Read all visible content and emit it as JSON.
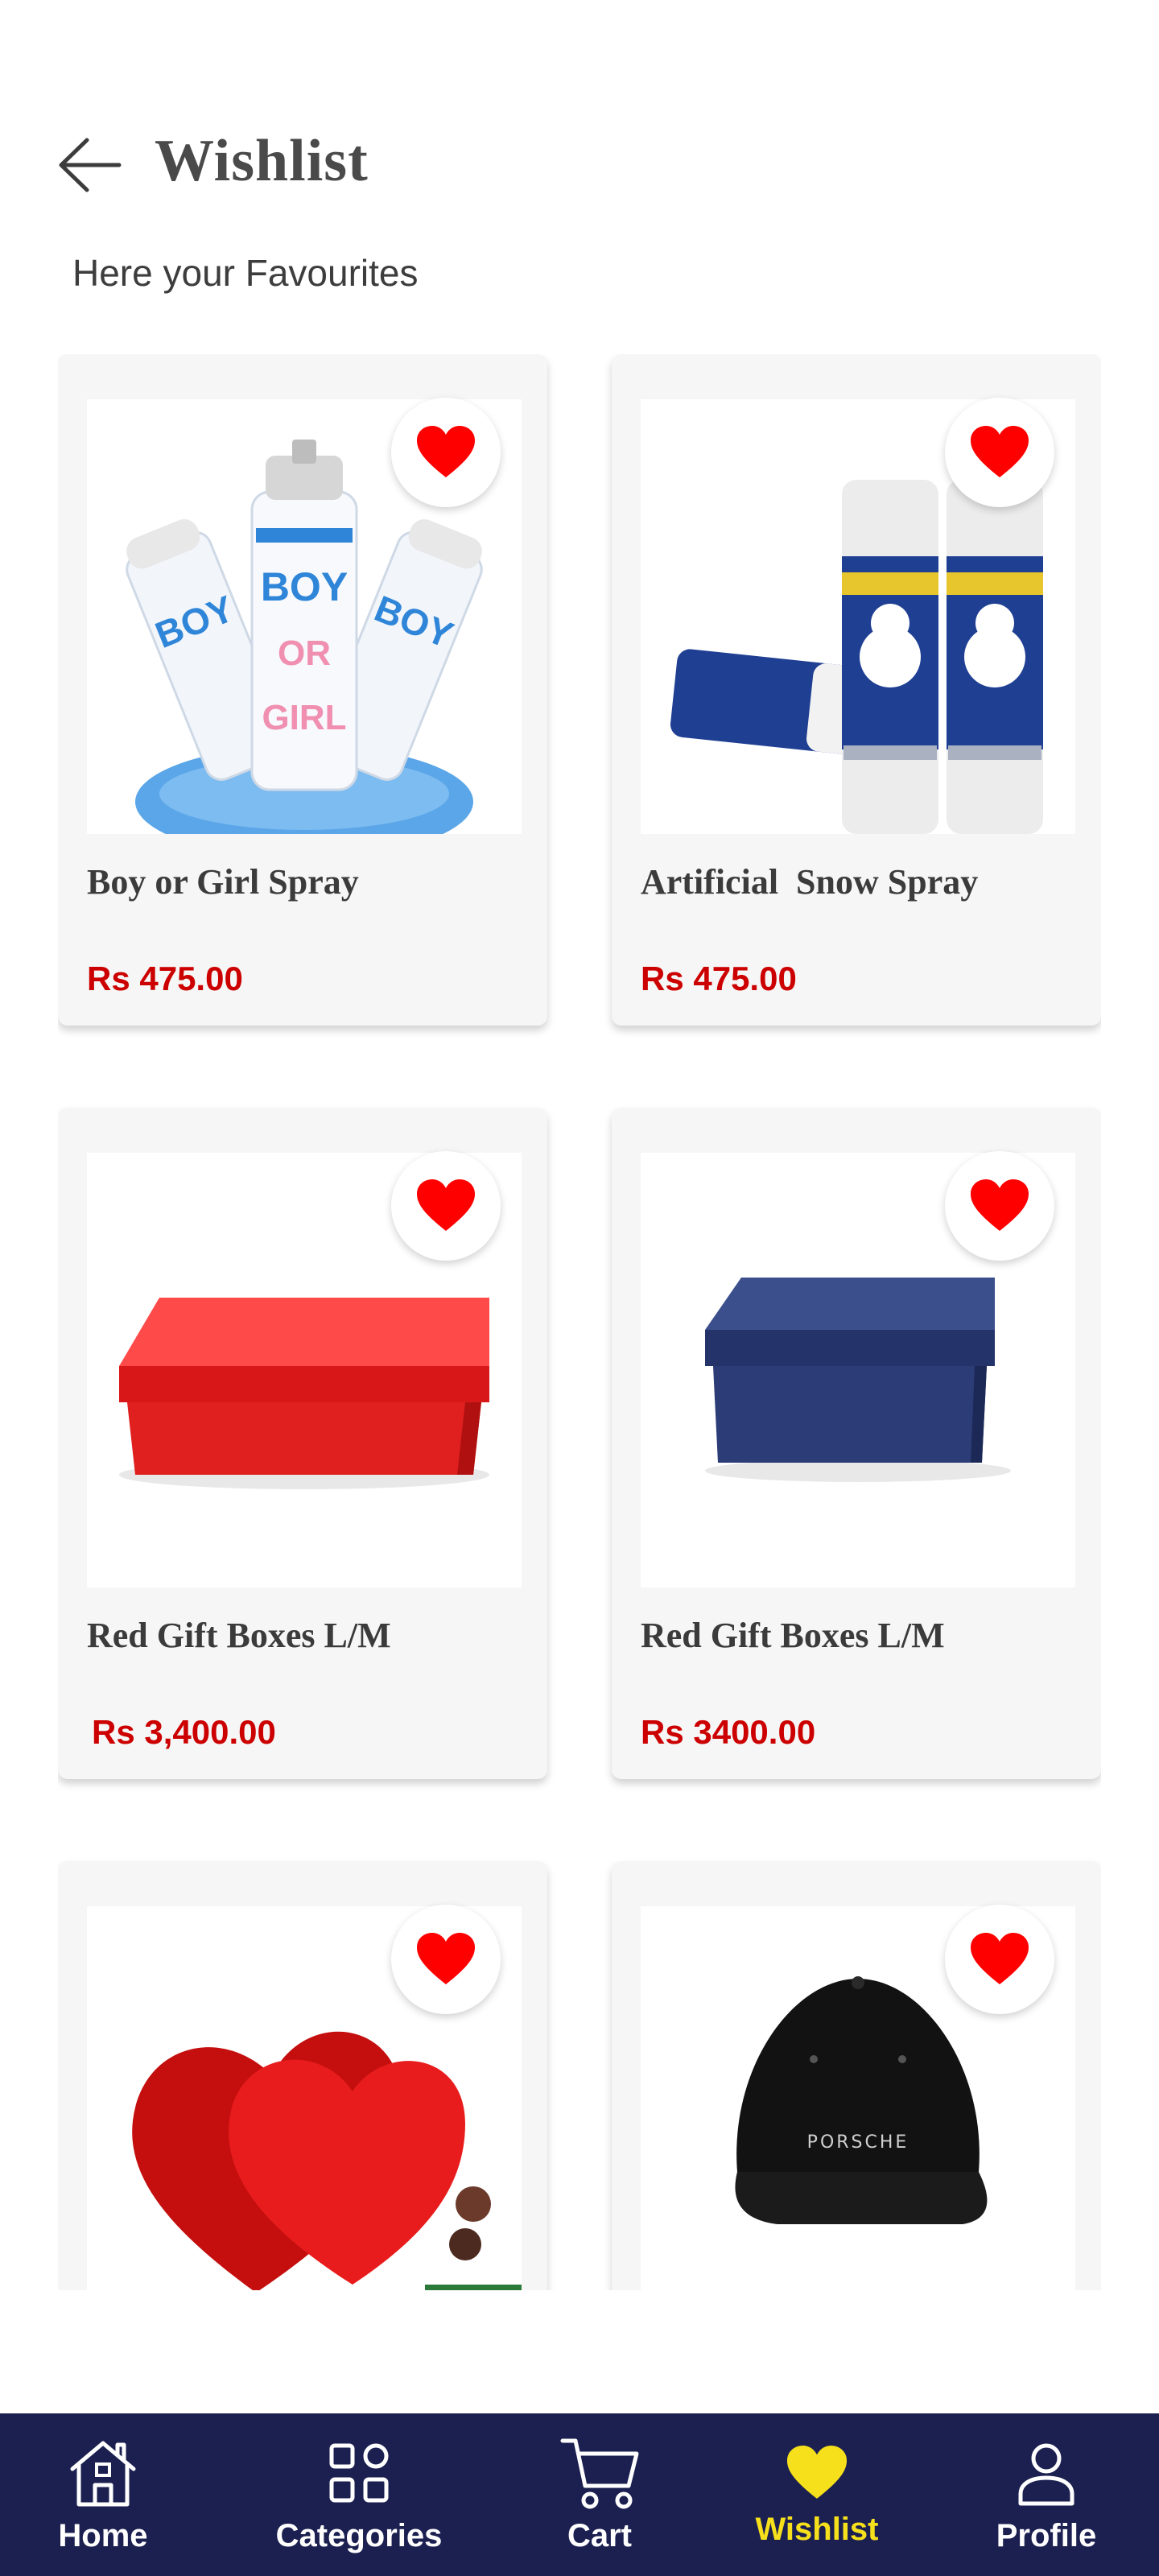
{
  "header": {
    "title": "Wishlist",
    "subtitle": "Here your Favourites"
  },
  "products": [
    {
      "name": "Boy or Girl Spray",
      "price": "Rs 475.00",
      "favorited": true,
      "image_icon": "spray-cans-image"
    },
    {
      "name": "Artificial  Snow Spray",
      "price": "Rs 475.00",
      "favorited": true,
      "image_icon": "snow-spray-image"
    },
    {
      "name": "Red Gift Boxes L/M",
      "price": "Rs 3,400.00",
      "favorited": true,
      "image_icon": "red-box-image"
    },
    {
      "name": "Red Gift Boxes L/M",
      "price": "Rs 3400.00",
      "favorited": true,
      "image_icon": "blue-box-image"
    },
    {
      "name": "",
      "price": "",
      "favorited": true,
      "image_icon": "heart-box-image"
    },
    {
      "name": "",
      "price": "",
      "favorited": true,
      "image_icon": "cap-image",
      "image_text": "PORSCHE"
    }
  ],
  "nav": {
    "items": [
      {
        "label": "Home",
        "icon": "home-icon"
      },
      {
        "label": "Categories",
        "icon": "grid-icon"
      },
      {
        "label": "Cart",
        "icon": "cart-icon"
      },
      {
        "label": "Wishlist",
        "icon": "heart-icon",
        "active": true
      },
      {
        "label": "Profile",
        "icon": "user-icon"
      }
    ]
  },
  "colors": {
    "nav_bg": "#1b2050",
    "accent": "#f6e01c",
    "price": "#cc0000",
    "heart": "#ff0000"
  }
}
